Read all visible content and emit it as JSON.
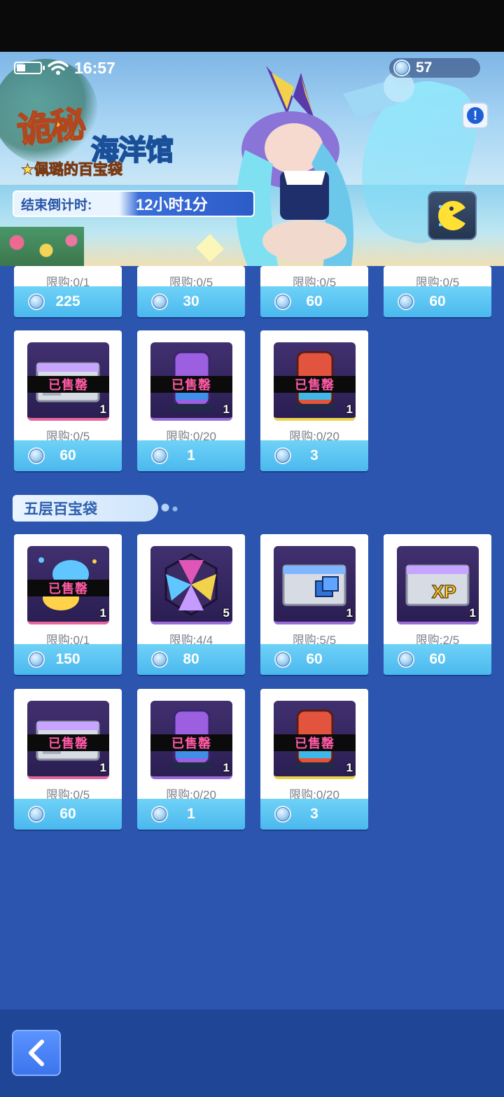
{
  "status_bar": {
    "time": "16:57"
  },
  "currency": {
    "amount": "57"
  },
  "banner": {
    "title_part1": "诡秘",
    "title_part2": "海洋馆",
    "subtitle": "★佩璐的百宝袋",
    "countdown_label": "结束倒计时:",
    "countdown_value": "12小时1分"
  },
  "sold_text": "已售罄",
  "section_header": "五层百宝袋",
  "partial_row": [
    {
      "limit": "限购:0/1",
      "price": "225"
    },
    {
      "limit": "限购:0/5",
      "price": "30"
    },
    {
      "limit": "限购:0/5",
      "price": "60"
    },
    {
      "limit": "限购:0/5",
      "price": "60"
    }
  ],
  "layer4_row2": [
    {
      "icon": "exp-card-icon",
      "qty": "1",
      "limit": "限购:0/5",
      "price": "60",
      "sold": true
    },
    {
      "icon": "purple-capsule-icon",
      "qty": "1",
      "limit": "限购:0/20",
      "price": "1",
      "sold": true
    },
    {
      "icon": "red-capsule-icon",
      "qty": "1",
      "limit": "限购:0/20",
      "price": "3",
      "sold": true
    }
  ],
  "layer5_row1": [
    {
      "icon": "planet-gem-icon",
      "qty": "1",
      "limit": "限购:0/1",
      "price": "150",
      "sold": true
    },
    {
      "icon": "crystal-wheel-icon",
      "qty": "5",
      "limit": "限购:4/4",
      "price": "80",
      "sold": false
    },
    {
      "icon": "exp-blue-card-icon",
      "qty": "1",
      "limit": "限购:5/5",
      "price": "60",
      "sold": false
    },
    {
      "icon": "exp-xp-card-icon",
      "qty": "1",
      "limit": "限购:2/5",
      "price": "60",
      "sold": false,
      "xp_text": "XP"
    }
  ],
  "layer5_row2": [
    {
      "icon": "exp-card-icon",
      "qty": "1",
      "limit": "限购:0/5",
      "price": "60",
      "sold": true
    },
    {
      "icon": "purple-capsule-icon",
      "qty": "1",
      "limit": "限购:0/20",
      "price": "1",
      "sold": true
    },
    {
      "icon": "red-capsule-icon",
      "qty": "1",
      "limit": "限购:0/20",
      "price": "3",
      "sold": true
    }
  ]
}
